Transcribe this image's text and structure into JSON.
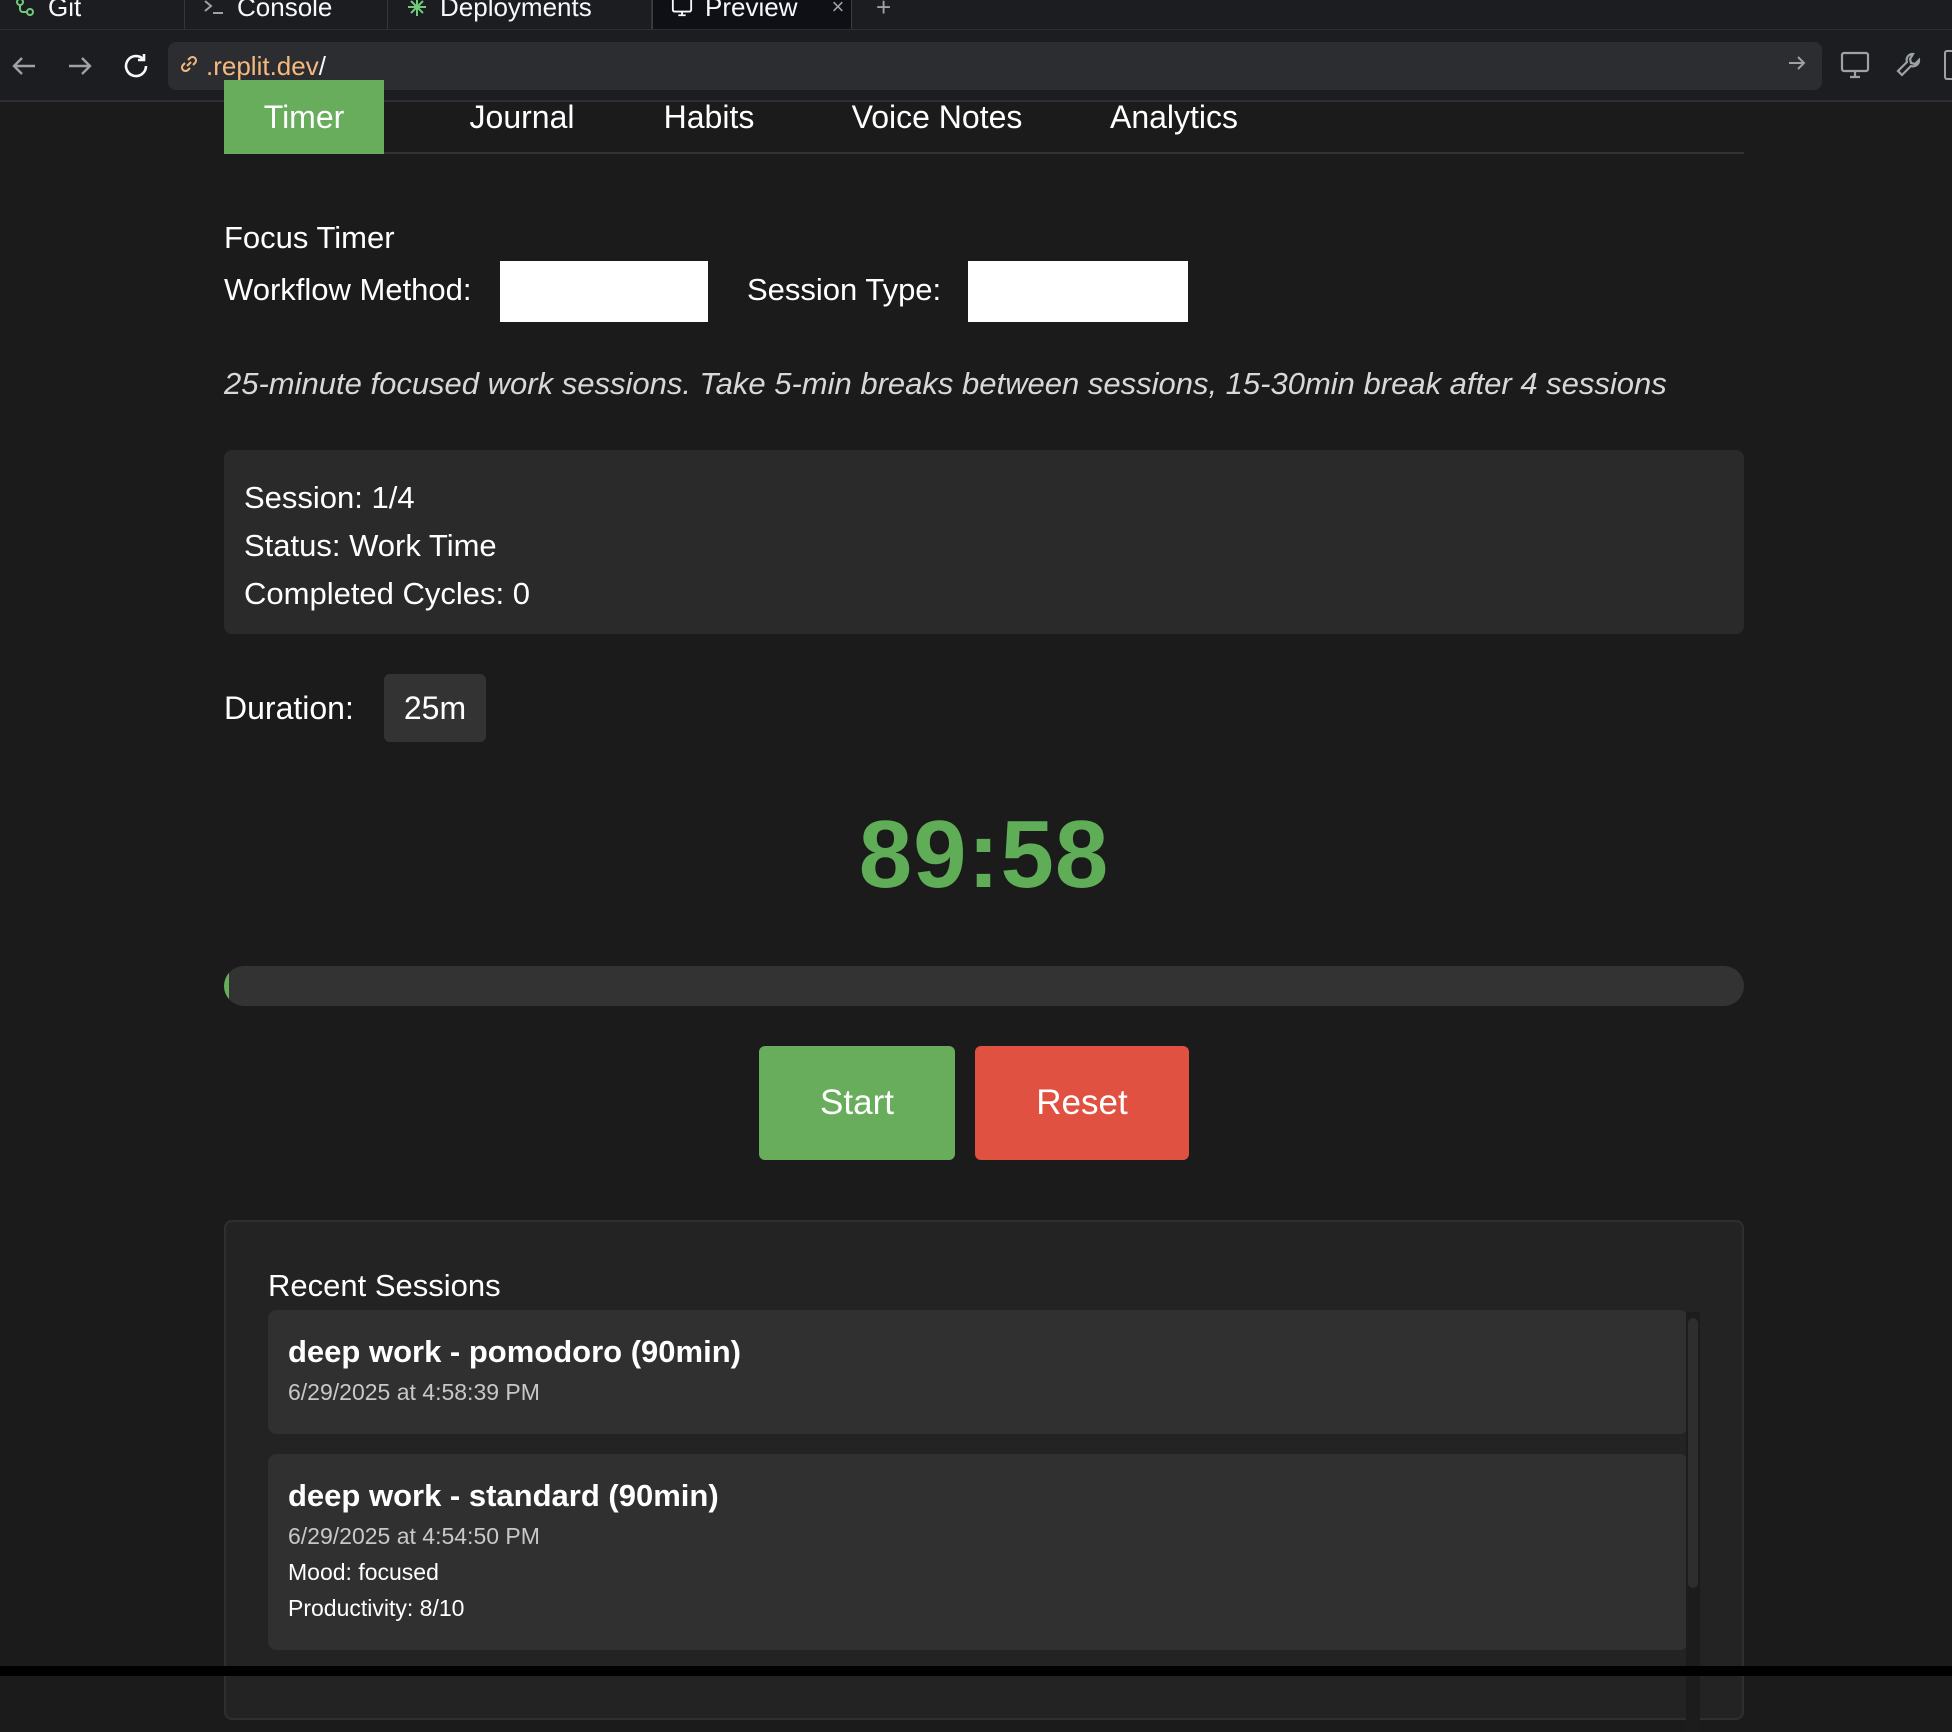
{
  "browser": {
    "tabs": [
      {
        "label": "Git",
        "icon": "git-icon"
      },
      {
        "label": "Console",
        "icon": "console-icon"
      },
      {
        "label": "Deployments",
        "icon": "deployments-icon"
      },
      {
        "label": "Preview",
        "icon": "preview-icon",
        "active": true,
        "close": "×"
      }
    ],
    "add_tab": "+",
    "url_host": ".replit.dev",
    "url_path": "/"
  },
  "app": {
    "nav": [
      {
        "label": "Timer",
        "active": true
      },
      {
        "label": "Journal"
      },
      {
        "label": "Habits"
      },
      {
        "label": "Voice Notes"
      },
      {
        "label": "Analytics"
      }
    ],
    "section_title": "Focus Timer",
    "workflow_label": "Workflow Method:",
    "workflow_value": "",
    "session_type_label": "Session Type:",
    "session_type_value": "",
    "description": "25-minute focused work sessions. Take 5-min breaks between sessions, 15-30min break after 4 sessions",
    "info": {
      "session": "Session: 1/4",
      "status": "Status: Work Time",
      "cycles": "Completed Cycles: 0"
    },
    "duration_label": "Duration:",
    "duration_value": "25m",
    "timer": "89:58",
    "progress_fraction": 0.003,
    "start_label": "Start",
    "reset_label": "Reset",
    "recent_title": "Recent Sessions",
    "sessions": [
      {
        "name": "deep work - pomodoro (90min)",
        "date": "6/29/2025 at 4:58:39 PM"
      },
      {
        "name": "deep work - standard (90min)",
        "date": "6/29/2025 at 4:54:50 PM",
        "mood": "Mood: focused",
        "productivity": "Productivity: 8/10"
      }
    ]
  },
  "colors": {
    "accent_green": "#67ad5b",
    "timer_green": "#5fad56",
    "reset_red": "#e05141",
    "background": "#1b1b1b",
    "url_orange": "#f5b97f"
  }
}
